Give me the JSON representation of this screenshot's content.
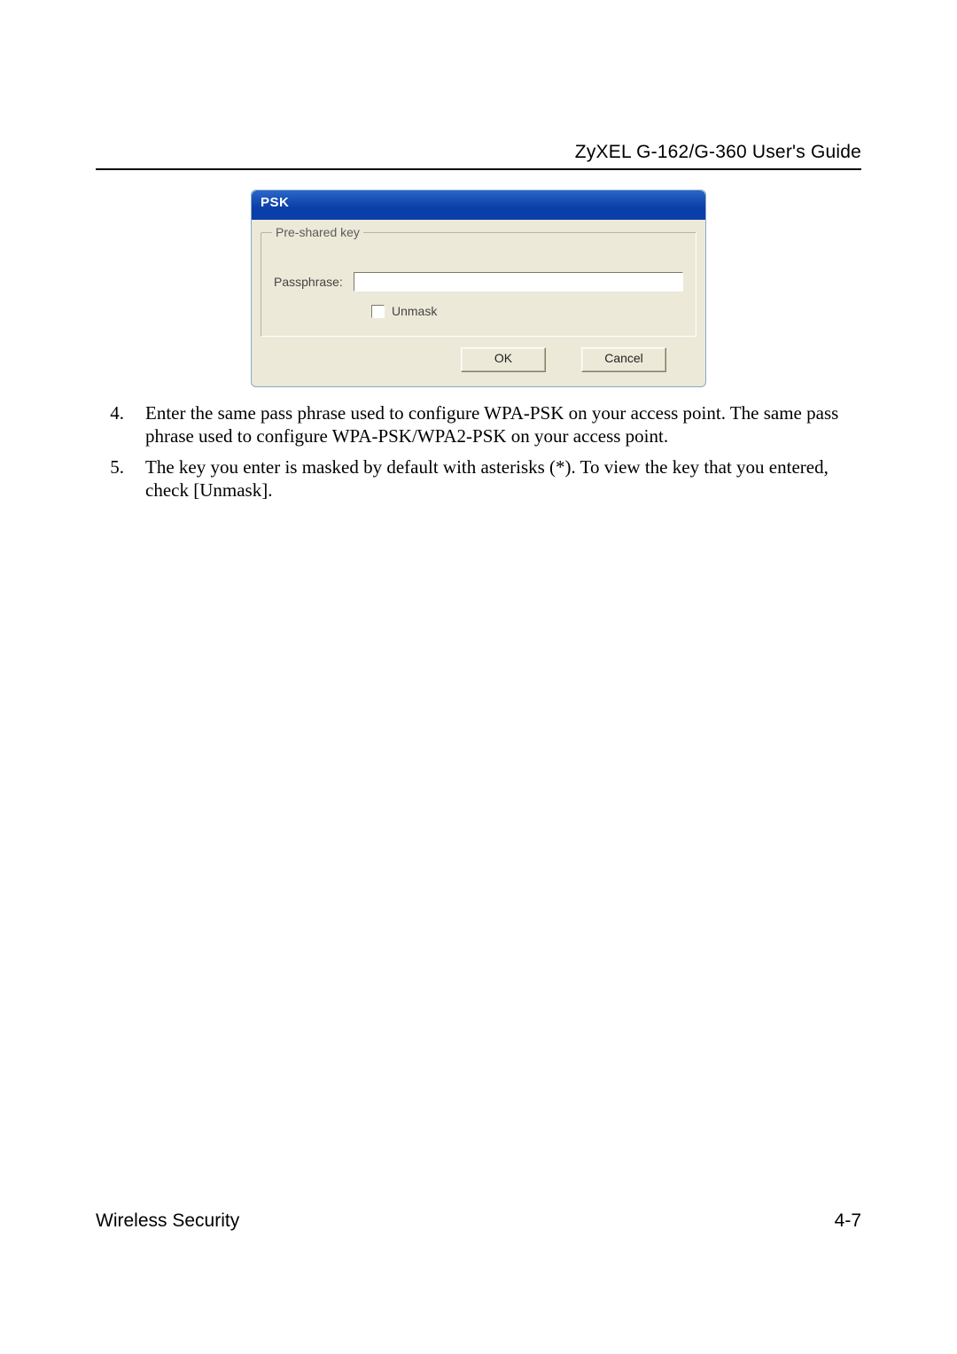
{
  "header": {
    "title": "ZyXEL G-162/G-360 User's Guide"
  },
  "dialog": {
    "title": "PSK",
    "group_legend": "Pre-shared key",
    "passphrase_label": "Passphrase:",
    "passphrase_value": "",
    "unmask_label": "Unmask",
    "ok_label": "OK",
    "cancel_label": "Cancel"
  },
  "list": {
    "items": [
      {
        "num": "4.",
        "text": "Enter the same pass phrase used to configure WPA-PSK on your access point. The same pass phrase used to configure WPA-PSK/WPA2-PSK on your access point."
      },
      {
        "num": "5.",
        "text": "The key you enter is masked by default with asterisks (*).  To view the key that you entered, check [Unmask]."
      }
    ]
  },
  "footer": {
    "section": "Wireless Security",
    "page": "4-7"
  }
}
